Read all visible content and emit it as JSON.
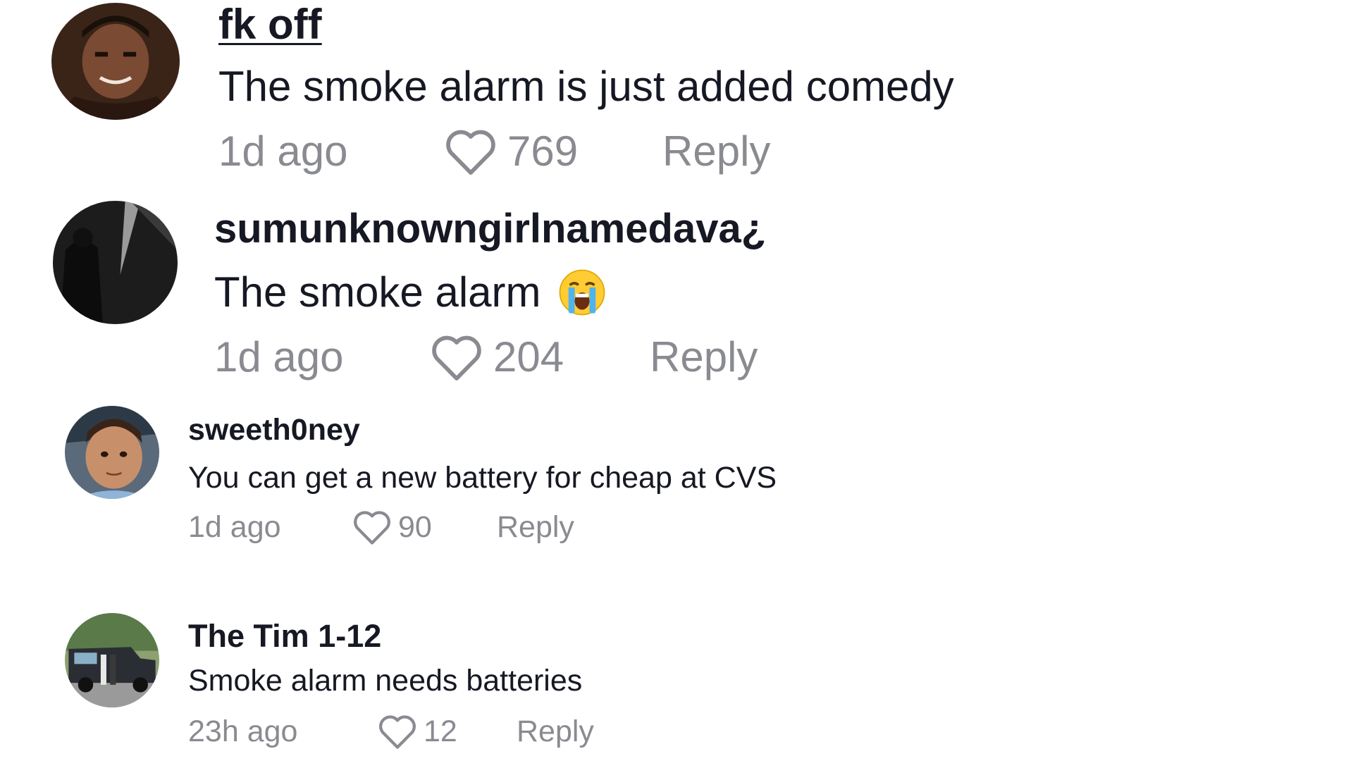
{
  "comments": [
    {
      "username": "fk off",
      "text": "The smoke alarm is just added comedy",
      "time": "1d ago",
      "likes": "769",
      "reply_label": "Reply"
    },
    {
      "username": "sumunknowngirlnamedava¿",
      "text": "The smoke alarm",
      "emoji": "loudly-crying-face",
      "time": "1d ago",
      "likes": "204",
      "reply_label": "Reply"
    },
    {
      "username": "sweeth0ney",
      "text": "You can get a new battery for cheap at CVS",
      "time": "1d ago",
      "likes": "90",
      "reply_label": "Reply"
    },
    {
      "username": "The Tim 1-12",
      "text": "Smoke alarm needs batteries",
      "time": "23h ago",
      "likes": "12",
      "reply_label": "Reply"
    }
  ],
  "icons": {
    "like": "heart-outline-icon"
  },
  "colors": {
    "username": "#161823",
    "text": "#161823",
    "meta": "#8a8b91"
  }
}
